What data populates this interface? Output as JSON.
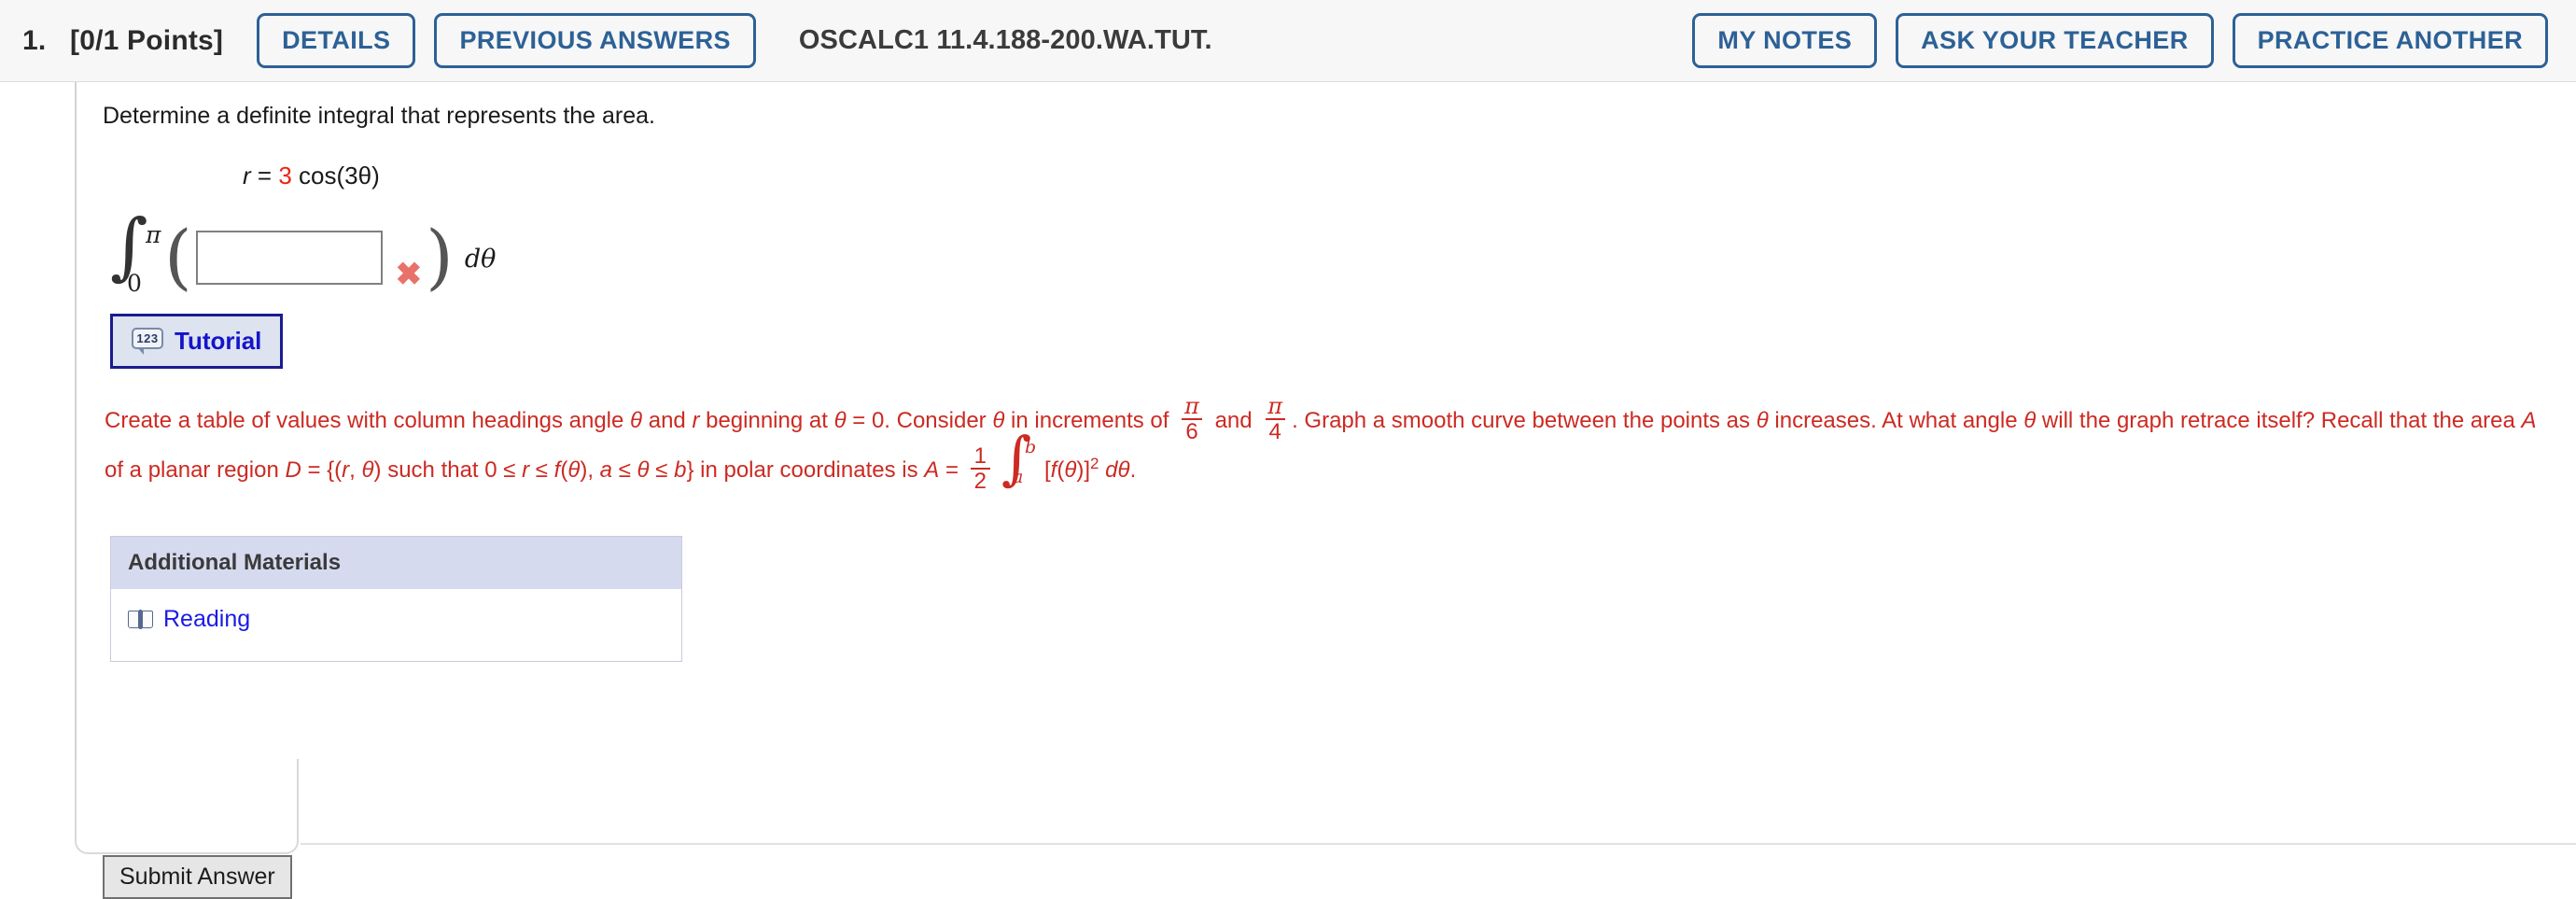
{
  "header": {
    "question_number": "1.",
    "points": "[0/1 Points]",
    "details_label": "DETAILS",
    "previous_answers_label": "PREVIOUS ANSWERS",
    "title": "OSCALC1 11.4.188-200.WA.TUT.",
    "my_notes_label": "MY NOTES",
    "ask_teacher_label": "ASK YOUR TEACHER",
    "practice_another_label": "PRACTICE ANOTHER",
    "accent_color": "#2d6196",
    "background_color": "#f7f7f7"
  },
  "problem": {
    "prompt": "Determine a definite integral that represents the area.",
    "equation": {
      "lhs": "r",
      "equals": "=",
      "coefficient": "3",
      "coefficient_color": "#ee2211",
      "rhs": "cos(3θ)"
    },
    "integral": {
      "lower_limit": "0",
      "upper_limit": "π",
      "integral_glyph": "∫",
      "open_paren": "(",
      "close_paren": ")",
      "answer_value": "",
      "answer_placeholder": "",
      "incorrect_mark": "✖",
      "incorrect_color": "#e8726b",
      "differential": "dθ"
    },
    "tutorial": {
      "label": "Tutorial",
      "icon_text": "123",
      "text_color": "#1414cc",
      "border_color": "#1b1b8f",
      "background_color": "#dde3ef"
    }
  },
  "hint": {
    "color": "#cc2a22",
    "seg1": "Create a table of values with column headings angle ",
    "theta_a": "θ",
    "seg2": " and ",
    "r_a": "r",
    "seg3": " beginning at ",
    "theta_b": "θ",
    "seg4": " = 0. Consider ",
    "theta_c": "θ",
    "seg5": " in increments of ",
    "frac1_num": "π",
    "frac1_den": "6",
    "seg6": " and ",
    "frac2_num": "π",
    "frac2_den": "4",
    "seg7": ". Graph a smooth curve between the points as ",
    "theta_d": "θ",
    "seg8": " increases. At what angle ",
    "theta_e": "θ",
    "seg9": " will the graph retrace itself? Recall that the area ",
    "var_A": "A",
    "seg10": " of a planar region ",
    "var_D1": "D",
    "seg11": " = {(",
    "var_r2": "r",
    "seg12": ", ",
    "theta_f": "θ",
    "seg13": ") such that 0 ≤ ",
    "var_r3": "r",
    "seg14": " ≤ ",
    "fn_f": "f",
    "seg15": "(",
    "theta_g": "θ",
    "seg16": "), ",
    "var_a": "a",
    "seg17": " ≤ ",
    "theta_h": "θ",
    "seg18": " ≤ ",
    "var_b": "b",
    "seg19": "} in polar coordinates is ",
    "var_A2": "A",
    "seg20": " = ",
    "frac3_num": "1",
    "frac3_den": "2",
    "int_glyph": "∫",
    "int_upper": "b",
    "int_lower": "a",
    "seg21": "[",
    "fn_f2": "f",
    "seg22": "(",
    "theta_i": "θ",
    "seg23": ")]",
    "exponent": "2",
    "seg24": " d",
    "theta_j": "θ",
    "seg25": "."
  },
  "materials": {
    "title": "Additional Materials",
    "header_background": "#d5daef",
    "items": [
      {
        "label": "Reading",
        "icon": "book-icon",
        "color": "#1a1ae6"
      }
    ]
  },
  "footer": {
    "submit_label": "Submit Answer"
  }
}
